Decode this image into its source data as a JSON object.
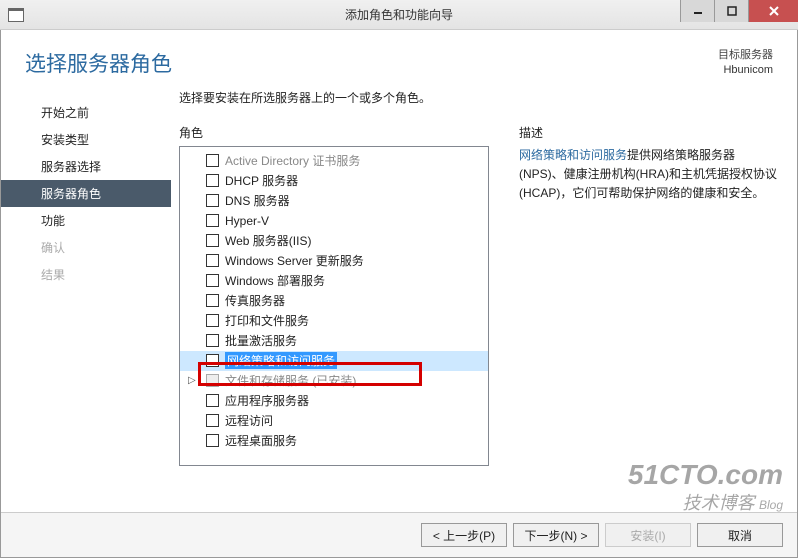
{
  "window": {
    "title": "添加角色和功能向导"
  },
  "header": {
    "page_title": "选择服务器角色",
    "dest_label": "目标服务器",
    "dest_name": "Hbunicom"
  },
  "sidebar": {
    "items": [
      {
        "label": "开始之前",
        "state": "normal"
      },
      {
        "label": "安装类型",
        "state": "normal"
      },
      {
        "label": "服务器选择",
        "state": "normal"
      },
      {
        "label": "服务器角色",
        "state": "selected"
      },
      {
        "label": "功能",
        "state": "normal"
      },
      {
        "label": "确认",
        "state": "disabled"
      },
      {
        "label": "结果",
        "state": "disabled"
      }
    ]
  },
  "main": {
    "instruction": "选择要安装在所选服务器上的一个或多个角色。",
    "roles_label": "角色",
    "desc_label": "描述",
    "roles": [
      {
        "label": "Active Directory 证书服务",
        "checked": false,
        "state": "cut"
      },
      {
        "label": "DHCP 服务器",
        "checked": false,
        "state": "normal"
      },
      {
        "label": "DNS 服务器",
        "checked": false,
        "state": "normal"
      },
      {
        "label": "Hyper-V",
        "checked": false,
        "state": "normal"
      },
      {
        "label": "Web 服务器(IIS)",
        "checked": false,
        "state": "normal"
      },
      {
        "label": "Windows Server 更新服务",
        "checked": false,
        "state": "normal"
      },
      {
        "label": "Windows 部署服务",
        "checked": false,
        "state": "normal"
      },
      {
        "label": "传真服务器",
        "checked": false,
        "state": "normal"
      },
      {
        "label": "打印和文件服务",
        "checked": false,
        "state": "normal"
      },
      {
        "label": "批量激活服务",
        "checked": false,
        "state": "normal"
      },
      {
        "label": "网络策略和访问服务",
        "checked": false,
        "state": "selected"
      },
      {
        "label": "文件和存储服务 (已安装)",
        "checked": false,
        "state": "installed",
        "expandable": true
      },
      {
        "label": "应用程序服务器",
        "checked": false,
        "state": "normal"
      },
      {
        "label": "远程访问",
        "checked": false,
        "state": "normal"
      },
      {
        "label": "远程桌面服务",
        "checked": false,
        "state": "normal"
      }
    ],
    "description": {
      "link_text": "网络策略和访问服务",
      "rest_text": "提供网络策略服务器(NPS)、健康注册机构(HRA)和主机凭据授权协议(HCAP)，它们可帮助保护网络的健康和安全。"
    }
  },
  "footer": {
    "prev": "< 上一步(P)",
    "next": "下一步(N) >",
    "install": "安装(I)",
    "cancel": "取消"
  },
  "watermark": {
    "line1": "51CTO.com",
    "line2": "技术博客",
    "line3": "Blog"
  }
}
